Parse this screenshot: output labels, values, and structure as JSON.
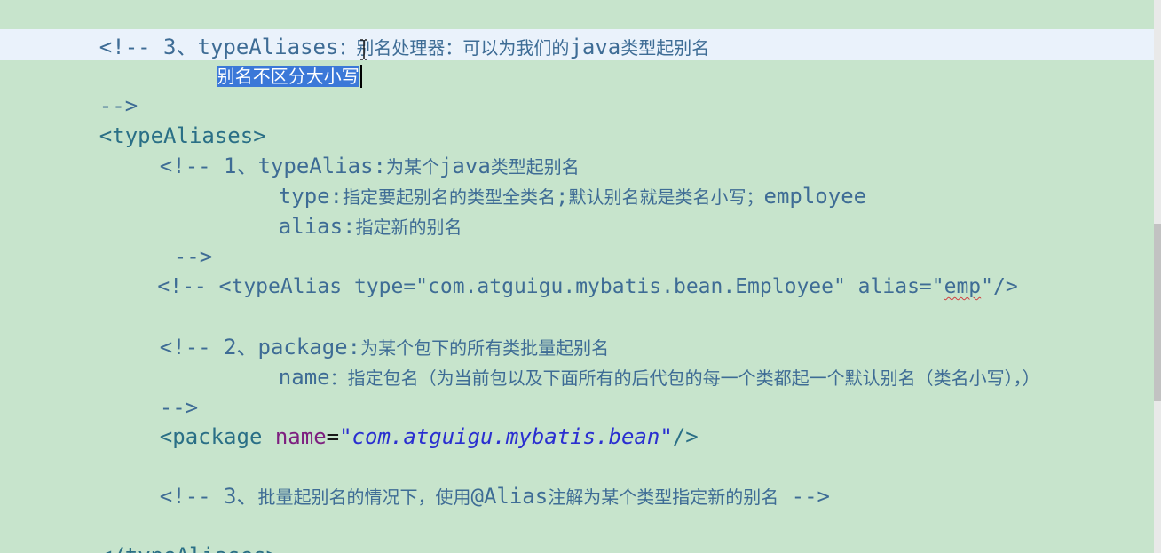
{
  "lines": {
    "l1": {
      "code": "<!-- 3、typeAliases",
      "cn": "：别名处理器：可以为我们的",
      "code2": "java",
      "cn2": "类型起别名"
    },
    "l2": {
      "selected": "别名不区分大小写"
    },
    "l3": {
      "code": "-->"
    },
    "l4": {
      "code": "<typeAliases>"
    },
    "l5": {
      "code": "<!-- 1、typeAlias:",
      "cn": "为某个",
      "code2": "java",
      "cn2": "类型起别名"
    },
    "l6": {
      "code": "type:",
      "cn": "指定要起别名的类型全类名",
      "code2": ";",
      "cn2": "默认别名就是类名小写；",
      "code3": "employee"
    },
    "l7": {
      "code": "alias:",
      "cn": "指定新的别名"
    },
    "l8": {
      "code": "-->"
    },
    "l9": {
      "code": "<!-- <typeAlias type=\"com.atguigu.mybatis.bean.Employee\" alias=\"",
      "squiggle": "emp",
      "code2": "\"/>"
    },
    "l10": {
      "code": "<!-- 2、package:",
      "cn": "为某个包下的所有类批量起别名"
    },
    "l11": {
      "code": "name",
      "cn": "：指定包名（为当前包以及下面所有的后代包的每一个类都起一个默认别名（类名小写），）"
    },
    "l12": {
      "code": "-->"
    },
    "l13": {
      "open": "<package ",
      "attr": "name",
      "eq": "=",
      "value": "\"com.atguigu.mybatis.bean\"",
      "close": "/>"
    },
    "l14": {
      "code": "<!-- 3、",
      "cn": "批量起别名的情况下，使用",
      "code2": "@Alias",
      "cn2": "注解为某个类型指定新的别名",
      "code3": " -->"
    },
    "l15": {
      "code": "</typeAliases>"
    }
  },
  "colors": {
    "background": "#c7e4cc",
    "current_line": "#eaf2fb",
    "selection": "#3b78d8",
    "comment": "#3e6c95",
    "attribute": "#7d1f7f",
    "string": "#2a2fd0"
  }
}
